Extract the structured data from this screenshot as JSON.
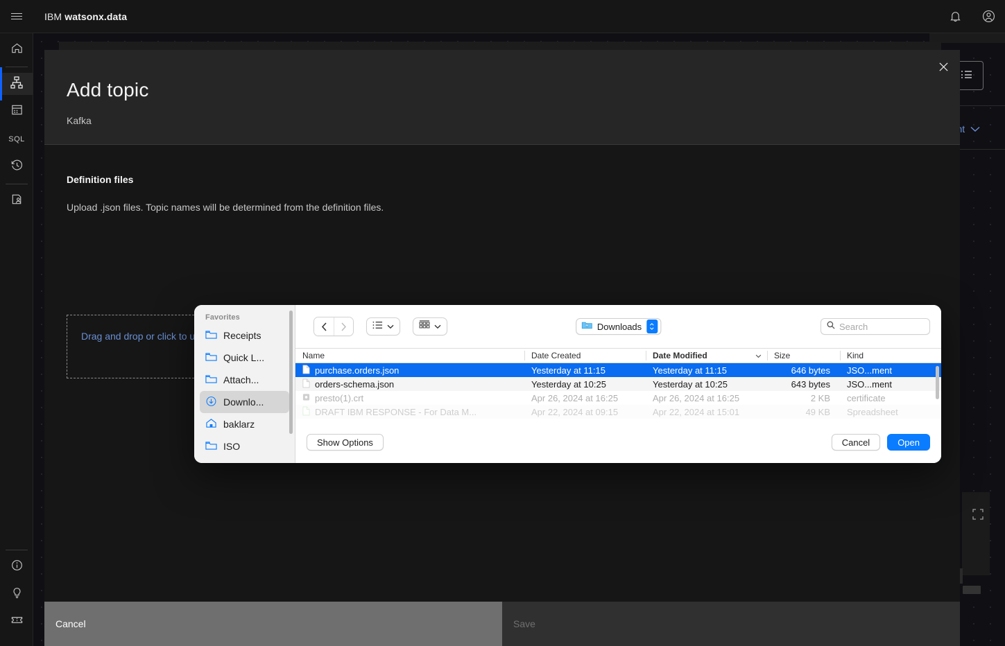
{
  "header": {
    "menu_icon": "hamburger-icon",
    "brand_prefix": "IBM",
    "brand_name": "watsonx.data",
    "notification_icon": "bell-icon",
    "account_icon": "user-avatar-icon"
  },
  "rail": {
    "items": [
      {
        "name": "home",
        "icon": "home-icon",
        "label": ""
      },
      {
        "name": "infrastructure",
        "icon": "infrastructure-icon",
        "label": ""
      },
      {
        "name": "data-manager",
        "icon": "data-table-icon",
        "label": ""
      },
      {
        "name": "query-workspace",
        "icon": "sql-icon",
        "label": "SQL"
      },
      {
        "name": "query-history",
        "icon": "history-icon",
        "label": ""
      },
      {
        "name": "access-control",
        "icon": "user-policy-icon",
        "label": ""
      }
    ],
    "bottom_items": [
      {
        "name": "about",
        "icon": "info-icon"
      },
      {
        "name": "tips",
        "icon": "lightbulb-icon"
      },
      {
        "name": "support",
        "icon": "ticket-icon"
      }
    ]
  },
  "background": {
    "env_link_label": "ment",
    "env_chevron_icon": "chevron-down-icon",
    "list_button_icon": "list-icon",
    "expand_icon": "expand-fullscreen-icon"
  },
  "modal": {
    "title": "Add topic",
    "subtitle": "Kafka",
    "close_icon": "close-icon",
    "section_title": "Definition files",
    "section_description": "Upload .json files. Topic names will be determined from the definition files.",
    "dropzone_label": "Drag and drop or click to upload .json files",
    "cancel_label": "Cancel",
    "save_label": "Save"
  },
  "file_dialog": {
    "sidebar": {
      "group_label": "Favorites",
      "items": [
        {
          "label": "Receipts",
          "icon": "folder-icon",
          "selected": false
        },
        {
          "label": "Quick L...",
          "icon": "folder-icon",
          "selected": false
        },
        {
          "label": "Attach...",
          "icon": "folder-icon",
          "selected": false
        },
        {
          "label": "Downlo...",
          "icon": "downloads-icon",
          "selected": true
        },
        {
          "label": "baklarz",
          "icon": "home-folder-icon",
          "selected": false
        },
        {
          "label": "ISO",
          "icon": "folder-icon",
          "selected": false
        }
      ]
    },
    "toolbar": {
      "back_icon": "chevron-left-icon",
      "forward_icon": "chevron-right-icon",
      "view_icon": "list-view-icon",
      "view_chevron_icon": "chevron-down-icon",
      "group_icon": "group-by-icon",
      "group_chevron_icon": "chevron-down-icon",
      "path_label": "Downloads",
      "path_icon": "downloads-folder-icon",
      "stepper_icon": "up-down-stepper-icon",
      "search_icon": "search-icon",
      "search_placeholder": "Search",
      "search_value": ""
    },
    "columns": [
      {
        "key": "name",
        "label": "Name",
        "sorted": false
      },
      {
        "key": "date_created",
        "label": "Date Created",
        "sorted": false
      },
      {
        "key": "date_modified",
        "label": "Date Modified",
        "sorted": true
      },
      {
        "key": "size",
        "label": "Size",
        "sorted": false
      },
      {
        "key": "kind",
        "label": "Kind",
        "sorted": false
      }
    ],
    "sort_chevron_icon": "chevron-down-icon",
    "rows": [
      {
        "name": "purchase.orders.json",
        "icon": "json-file-icon",
        "date_created": "Yesterday at 11:15",
        "date_modified": "Yesterday at 11:15",
        "size": "646 bytes",
        "kind": "JSO...ment",
        "state": "selected"
      },
      {
        "name": "orders-schema.json",
        "icon": "json-file-icon",
        "date_created": "Yesterday at 10:25",
        "date_modified": "Yesterday at 10:25",
        "size": "643 bytes",
        "kind": "JSO...ment",
        "state": "alt"
      },
      {
        "name": "presto(1).crt",
        "icon": "certificate-file-icon",
        "date_created": "Apr 26, 2024 at 16:25",
        "date_modified": "Apr 26, 2024 at 16:25",
        "size": "2 KB",
        "kind": "certificate",
        "state": "dim"
      },
      {
        "name": "DRAFT IBM RESPONSE - For Data M...",
        "icon": "document-file-icon",
        "date_created": "Apr 22, 2024 at 09:15",
        "date_modified": "Apr 22, 2024 at 15:01",
        "size": "49 KB",
        "kind": "Spreadsheet",
        "state": "clip"
      }
    ],
    "footer": {
      "show_options_label": "Show Options",
      "cancel_label": "Cancel",
      "open_label": "Open"
    }
  },
  "colors": {
    "accent_blue": "#0f62fe",
    "mac_blue": "#0a7cff",
    "selection_blue": "#0a6cf0",
    "link_blue": "#6a8fd4",
    "dark_bg": "#161616",
    "darker_bg": "#0f0f0f",
    "head_bg": "#262626"
  }
}
